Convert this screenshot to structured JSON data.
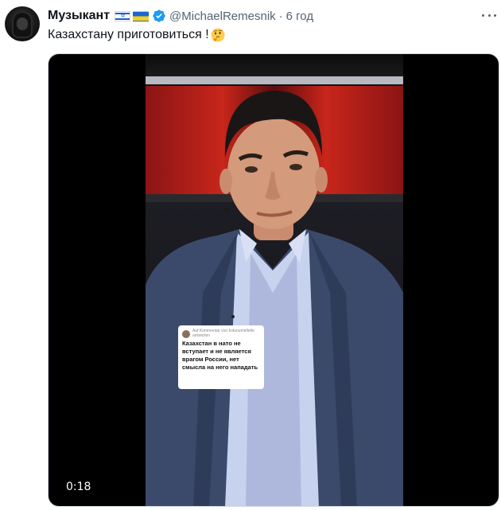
{
  "tweet": {
    "display_name": "Музыкант",
    "handle": "@MichaelRemesnik",
    "separator": "·",
    "time": "6 год",
    "text": "Казахстану приготовиться !",
    "emoji": "thinking-face"
  },
  "icons": {
    "verified": "verified-badge-icon",
    "more": "more-options-icon",
    "flags": [
      "israel-flag-icon",
      "ukraine-flag-icon"
    ]
  },
  "media": {
    "type": "video",
    "duration_label": "0:18",
    "caption": {
      "reply_note": "Auf Kommentar von kotunumelletle antworten",
      "text": "Казахстан в нато не вступает и не является врагом России, нет смысла на него нападать"
    }
  },
  "colors": {
    "text": "#0f1419",
    "secondary": "#536471",
    "verified": "#1d9bf0"
  }
}
